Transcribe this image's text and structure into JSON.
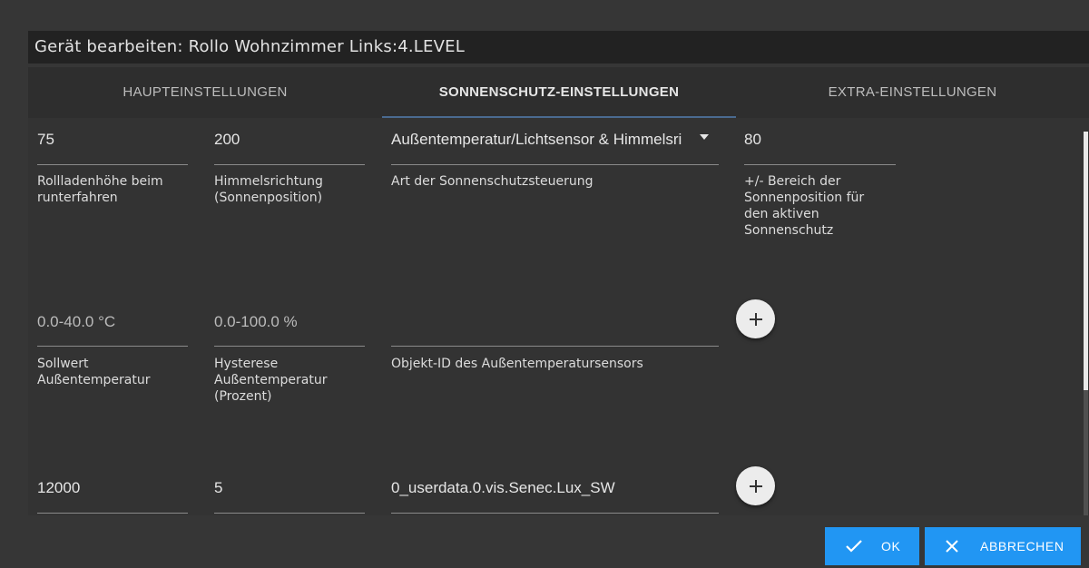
{
  "dialog": {
    "title": "Gerät bearbeiten: Rollo Wohnzimmer Links:4.LEVEL"
  },
  "tabs": [
    {
      "label": "HAUPTEINSTELLUNGEN",
      "active": false
    },
    {
      "label": "SONNENSCHUTZ-EINSTELLUNGEN",
      "active": true
    },
    {
      "label": "EXTRA-EINSTELLUNGEN",
      "active": false
    }
  ],
  "fields": {
    "shutter_height": {
      "value": "75",
      "label": "Rollladenhöhe beim runterfahren"
    },
    "sky_direction": {
      "value": "200",
      "label": "Himmelsrichtung (Sonnenposition)"
    },
    "sunprotect_type": {
      "value": "Außentemperatur/Lichtsensor & Himmelsri",
      "label": "Art der Sonnenschutzsteuerung"
    },
    "sun_range": {
      "value": "80",
      "label": "+/- Bereich der Sonnenposition für den aktiven Sonnenschutz"
    },
    "outside_temp_setpoint": {
      "placeholder": "0.0-40.0 °C",
      "label": "Sollwert Außentemperatur"
    },
    "outside_temp_hysteresis": {
      "placeholder": "0.0-100.0 %",
      "label": "Hysterese Außentemperatur (Prozent)"
    },
    "outside_temp_sensor_id": {
      "value": "",
      "label": "Objekt-ID des Außentemperatursensors"
    },
    "light_setpoint": {
      "value": "12000"
    },
    "light_hysteresis": {
      "value": "5"
    },
    "light_sensor_id": {
      "value": "0_userdata.0.vis.Senec.Lux_SW"
    }
  },
  "icons": {
    "add": "plus-icon",
    "ok": "check-icon",
    "cancel": "close-icon",
    "dropdown": "dropdown-arrow-icon"
  },
  "buttons": {
    "ok": "OK",
    "cancel": "ABBRECHEN"
  },
  "colors": {
    "accent": "#2196f3",
    "tab_indicator": "#4a6a90",
    "background": "#363636",
    "title_bar": "#222222"
  }
}
